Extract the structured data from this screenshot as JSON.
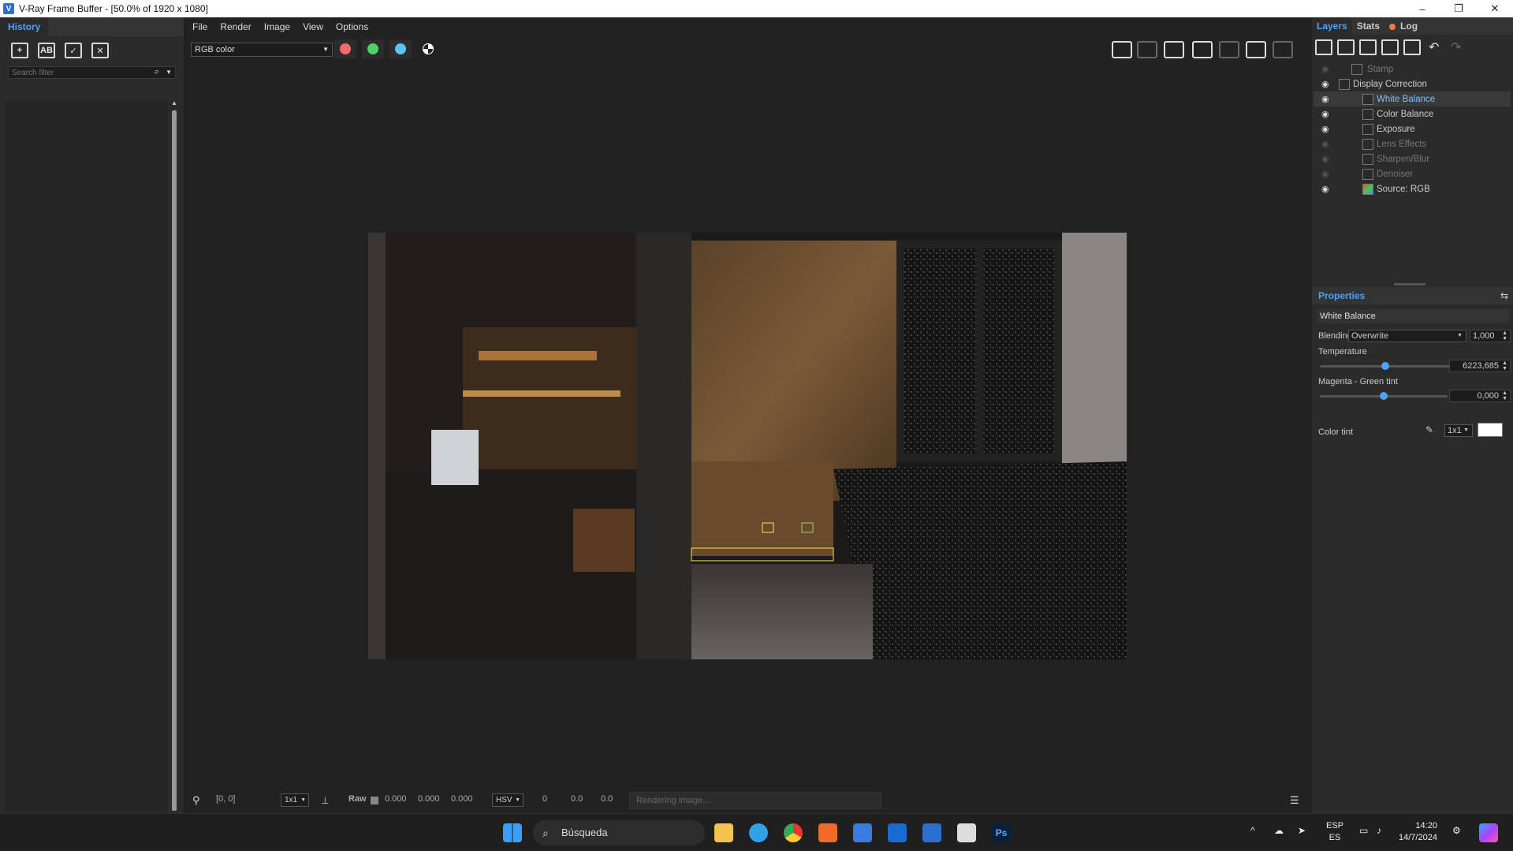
{
  "window": {
    "title": "V-Ray Frame Buffer - [50.0% of 1920 x 1080]",
    "controls": {
      "minimize": "–",
      "maximize": "❐",
      "close": "✕"
    }
  },
  "history": {
    "tab": "History",
    "search_placeholder": "Search filter"
  },
  "menu": [
    "File",
    "Render",
    "Image",
    "View",
    "Options"
  ],
  "toolbar": {
    "channel": "RGB color",
    "channel_dots": [
      {
        "name": "red-channel",
        "color": "#f26b6b"
      },
      {
        "name": "green-channel",
        "color": "#4fd16a"
      },
      {
        "name": "blue-channel",
        "color": "#5cc4f2"
      }
    ]
  },
  "status": {
    "coords": "[0, 0]",
    "sample": "1x1",
    "raw_label": "Raw",
    "rgb_values": [
      "0.000",
      "0.000",
      "0.000"
    ],
    "color_mode": "HSV",
    "hsv_values": [
      "0",
      "0.0",
      "0.0"
    ],
    "progress_text": "Rendering image..."
  },
  "right": {
    "tabs": {
      "layers": "Layers",
      "stats": "Stats",
      "log": "Log"
    },
    "layers": [
      {
        "name": "Stamp",
        "visible": false,
        "indent": 1
      },
      {
        "name": "Display Correction",
        "visible": true,
        "indent": 1
      },
      {
        "name": "White Balance",
        "visible": true,
        "indent": 2,
        "selected": true
      },
      {
        "name": "Color Balance",
        "visible": true,
        "indent": 2
      },
      {
        "name": "Exposure",
        "visible": true,
        "indent": 2
      },
      {
        "name": "Lens Effects",
        "visible": false,
        "indent": 2
      },
      {
        "name": "Sharpen/Blur",
        "visible": false,
        "indent": 2
      },
      {
        "name": "Denoiser",
        "visible": false,
        "indent": 2
      },
      {
        "name": "Source: RGB",
        "visible": true,
        "indent": 2
      }
    ],
    "properties": {
      "title": "Properties",
      "layer_name": "White Balance",
      "blending_label": "Blending",
      "blending_mode": "Overwrite",
      "blending_value": "1,000",
      "temperature_label": "Temperature",
      "temperature_value": "6223,685",
      "temperature_fraction": 0.45,
      "tint_label": "Magenta - Green tint",
      "tint_value": "0,000",
      "tint_fraction": 0.5,
      "color_tint_label": "Color tint",
      "color_tint_sample": "1x1",
      "color_tint_color": "#ffffff"
    }
  },
  "taskbar": {
    "search": "Búsqueda",
    "lang_top": "ESP",
    "lang_bottom": "ES",
    "time": "14:20",
    "date": "14/7/2024"
  }
}
